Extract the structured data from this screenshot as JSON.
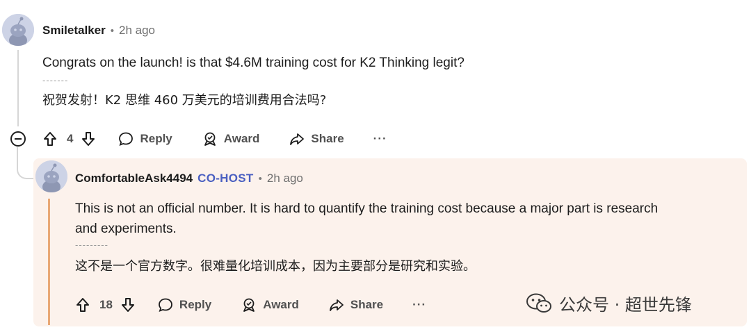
{
  "comment1": {
    "username": "Smiletalker",
    "time": "2h ago",
    "text_en": "Congrats on the launch! is that $4.6M training cost for K2 Thinking legit?",
    "text_zh": "祝贺发射！K2 思维 460 万美元的培训费用合法吗?",
    "votes": "4",
    "reply_label": "Reply",
    "award_label": "Award",
    "share_label": "Share",
    "more_label": "···"
  },
  "comment2": {
    "username": "ComfortableAsk4494",
    "badge": "CO-HOST",
    "time": "2h ago",
    "text_en_1": "This is not an official number. It is hard to quantify the training cost because a major part is research",
    "text_en_2": "and experiments.",
    "text_zh": "这不是一个官方数字。很难量化培训成本，因为主要部分是研究和实验。",
    "votes": "18",
    "reply_label": "Reply",
    "award_label": "Award",
    "share_label": "Share",
    "more_label": "···"
  },
  "separator": "•",
  "dashes_short": "-------",
  "dashes_long": "---------",
  "watermark": "公众号 · 超世先锋",
  "colors": {
    "cohost": "#4a5fc1",
    "reply_bg": "#fcf2ec",
    "op_bar": "#e8a876"
  }
}
